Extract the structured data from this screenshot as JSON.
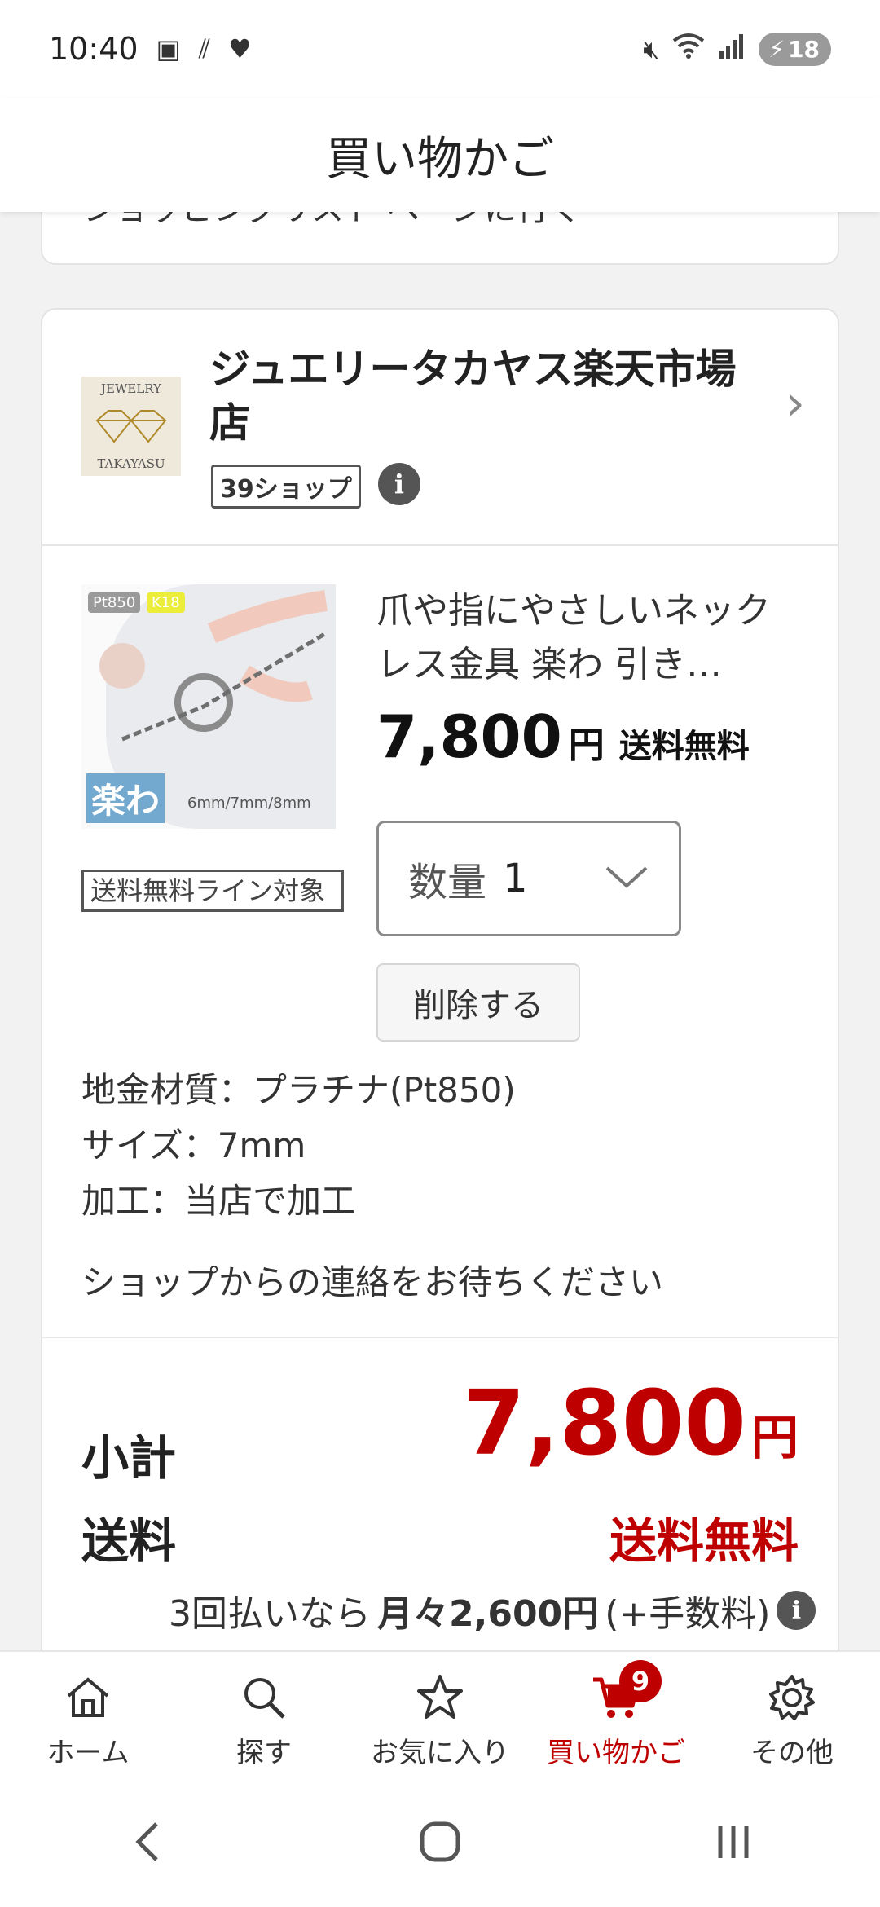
{
  "status_bar": {
    "time": "10:40",
    "battery": "18"
  },
  "header": {
    "title": "買い物かご"
  },
  "previous_card": {
    "text": "ショッピングリスト ページに行く"
  },
  "shop": {
    "logo_text_top": "JEWELRY",
    "logo_text_bottom": "TAKAYASU",
    "name": "ジュエリータカヤス楽天市場店",
    "badge": "39ショップ",
    "info_icon": "i"
  },
  "item": {
    "image_tags": {
      "pt": "Pt850",
      "k": "K18",
      "rakuwa": "楽わ",
      "sizes": "6mm/7mm/8mm"
    },
    "free_shipping_line": "送料無料ライン対象",
    "title": "爪や指にやさしいネックレス金具 楽わ 引き…",
    "price": "7,800",
    "yen": "円",
    "shipping": "送料無料",
    "quantity_label": "数量",
    "quantity_value": "1",
    "delete_label": "削除する",
    "options": [
      "地金材質：プラチナ(Pt850)",
      "サイズ：7mm",
      "加工：当店で加工"
    ],
    "shop_note": "ショップからの連絡をお待ちください"
  },
  "summary": {
    "subtotal_label": "小計",
    "subtotal_value": "7,800",
    "subtotal_yen": "円",
    "shipping_label": "送料",
    "shipping_value": "送料無料",
    "installment_prefix": "3回払いなら",
    "installment_amount": "月々2,600円",
    "installment_suffix": "(+手数料)"
  },
  "bottom_nav": {
    "items": [
      {
        "label": "ホーム",
        "icon": "home-icon"
      },
      {
        "label": "探す",
        "icon": "search-icon"
      },
      {
        "label": "お気に入り",
        "icon": "star-icon"
      },
      {
        "label": "買い物かご",
        "icon": "cart-icon"
      },
      {
        "label": "その他",
        "icon": "gear-icon"
      }
    ],
    "cart_count": "9",
    "active": "買い物かご"
  },
  "colors": {
    "accent": "#bf0000",
    "background": "#f2f2f2"
  }
}
